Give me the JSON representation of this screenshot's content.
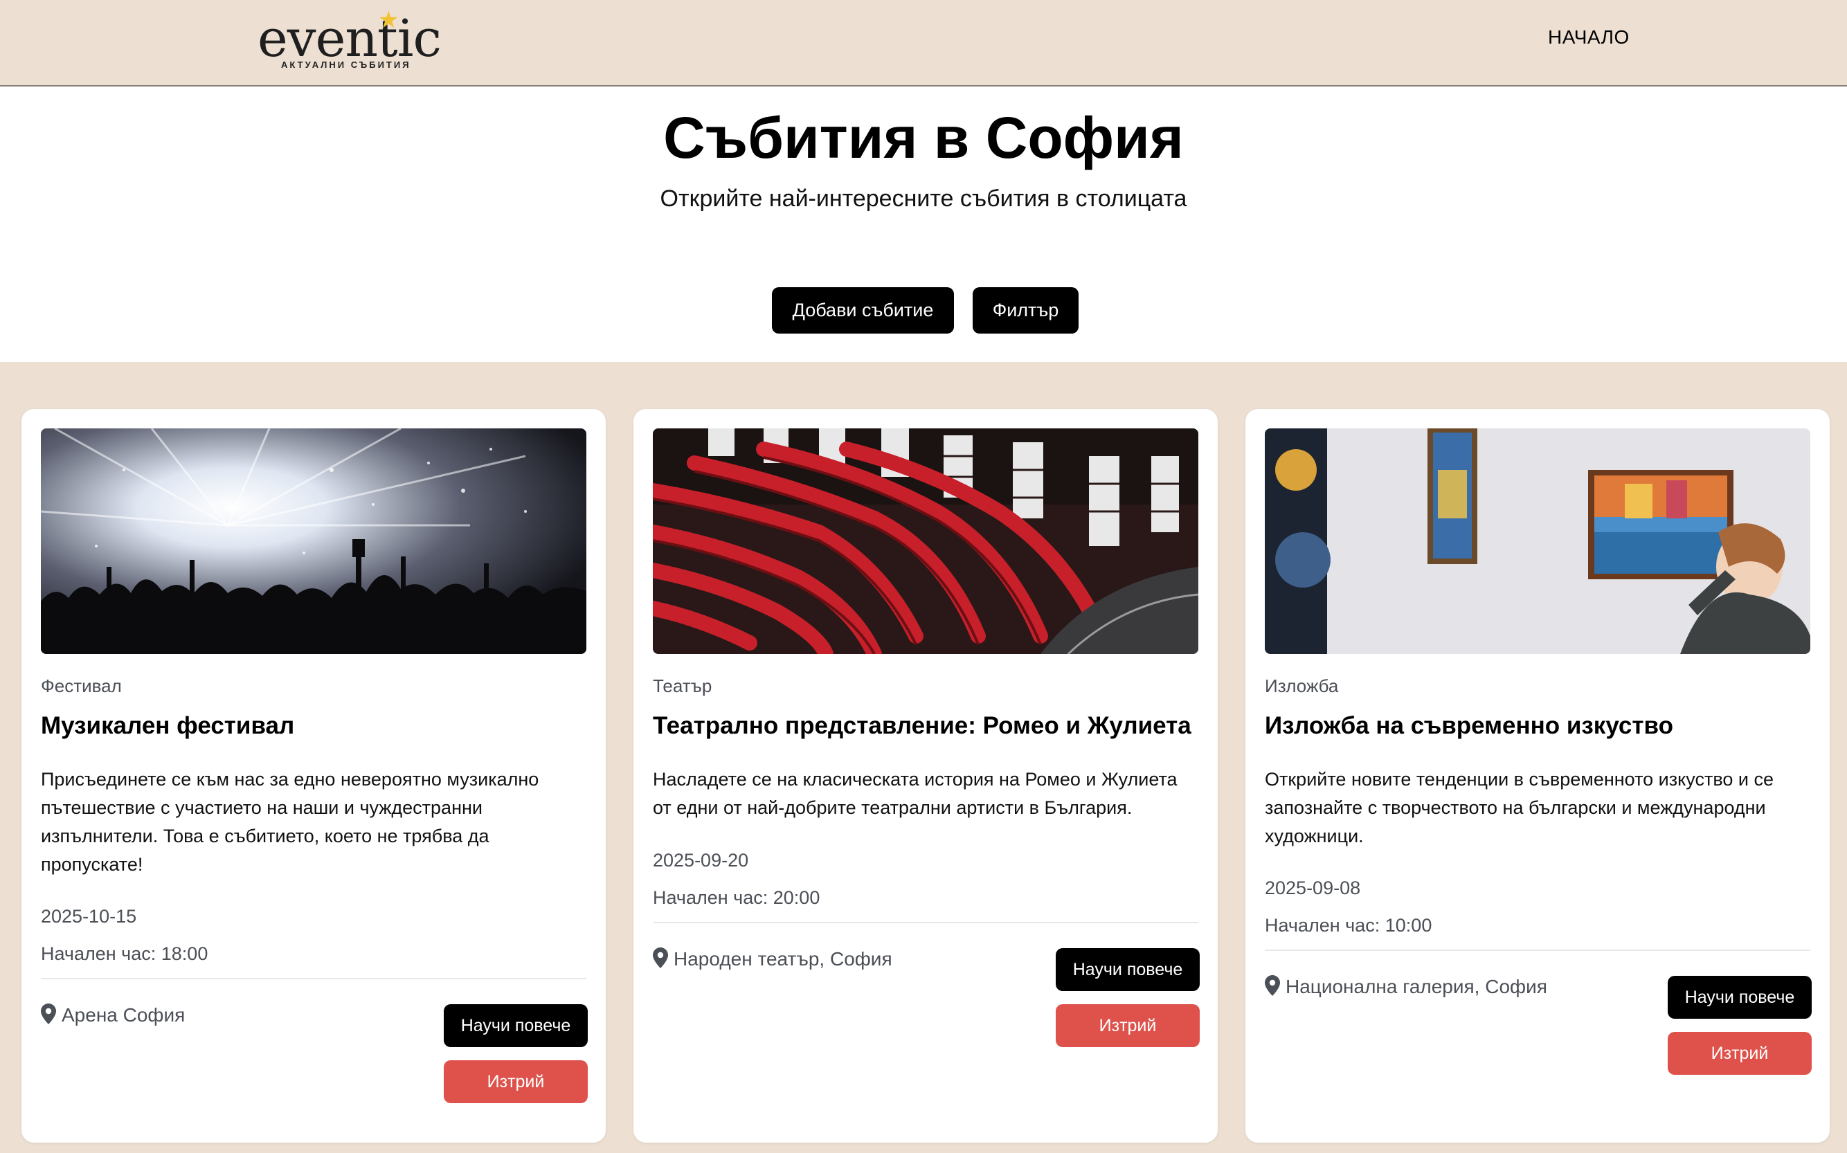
{
  "header": {
    "logo_word": "eventic",
    "logo_tagline": "АКТУАЛНИ СЪБИТИЯ",
    "nav_home": "НАЧАЛО"
  },
  "hero": {
    "title": "Събития в София",
    "subtitle": "Открийте най-интересните събития в столицата",
    "add_button": "Добави събитие",
    "filter_button": "Филтър"
  },
  "events": [
    {
      "category": "Фестивал",
      "title": "Музикален фестивал",
      "description": "Присъединете се към нас за едно невероятно музикално пътешествие с участието на наши и чуждестранни изпълнители. Това е събитието, което не трябва да пропускате!",
      "date": "2025-10-15",
      "time": "Начален час: 18:00",
      "location": "Арена София",
      "more_button": "Научи повече",
      "delete_button": "Изтрий",
      "image": "concert-crowd-photo"
    },
    {
      "category": "Театър",
      "title": "Театрално представление: Ромео и Жулиета",
      "description": "Насладете се на класическата история на Ромео и Жулиета от едни от най-добрите театрални артисти в България.",
      "date": "2025-09-20",
      "time": "Начален час: 20:00",
      "location": "Народен театър, София",
      "more_button": "Научи повече",
      "delete_button": "Изтрий",
      "image": "theatre-red-seats-photo"
    },
    {
      "category": "Изложба",
      "title": "Изложба на съвременно изкуство",
      "description": "Открийте новите тенденции в съвременното изкуство и се запознайте с творчеството на български и международни художници.",
      "date": "2025-09-08",
      "time": "Начален час: 10:00",
      "location": "Национална галерия, София",
      "more_button": "Научи повече",
      "delete_button": "Изтрий",
      "image": "art-gallery-photo"
    }
  ],
  "colors": {
    "header_bg": "#ede0d3",
    "primary_button": "#000000",
    "delete_button": "#de524b",
    "muted_text": "#4b4f56"
  }
}
